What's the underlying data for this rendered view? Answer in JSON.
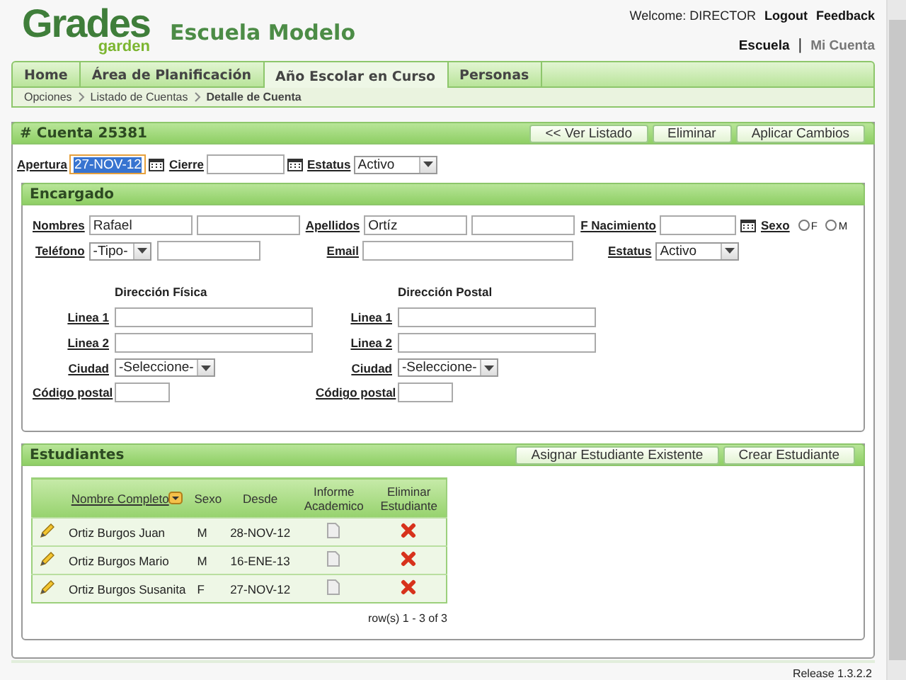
{
  "header": {
    "logo": {
      "title": "Grades",
      "subtitle": "garden"
    },
    "school": "Escuela Modelo",
    "welcome": "Welcome: DIRECTOR",
    "links": [
      "Logout",
      "Feedback"
    ],
    "context": [
      {
        "label": "Escuela",
        "selected": true
      },
      {
        "label": "Mi Cuenta",
        "selected": false
      }
    ],
    "separator": "|"
  },
  "tabs": [
    {
      "label": "Home",
      "selected": false
    },
    {
      "label": "Área de Planificación",
      "selected": false
    },
    {
      "label": "Año Escolar en Curso",
      "selected": true
    },
    {
      "label": "Personas",
      "selected": false
    }
  ],
  "breadcrumb": [
    {
      "label": "Opciones",
      "current": false
    },
    {
      "label": "Listado de Cuentas",
      "current": false
    },
    {
      "label": "Detalle de Cuenta",
      "current": true
    }
  ],
  "account": {
    "title": "# Cuenta 25381",
    "buttons": [
      "<< Ver Listado",
      "Eliminar",
      "Aplicar Cambios"
    ],
    "fields": [
      {
        "kind": "date",
        "label": "Apertura",
        "value": "27-NOV-12",
        "focused": true
      },
      {
        "kind": "date",
        "label": "Cierre"
      },
      {
        "kind": "select",
        "label": "Estatus",
        "value": "Activo"
      }
    ]
  },
  "guardian": {
    "title": "Encargado",
    "row1": {
      "nombres_label": "Nombres",
      "nombres": "Rafael",
      "apellidos_label": "Apellidos",
      "apellidos": "Ortíz",
      "birth_label": "F Nacimiento",
      "sexo_label": "Sexo",
      "sexo_options": [
        {
          "label": "F",
          "selected": false
        },
        {
          "label": "M",
          "selected": false
        }
      ]
    },
    "row2": {
      "phone_label": "Teléfono",
      "phone_type": "-Tipo-",
      "email_label": "Email",
      "status_label": "Estatus",
      "status": "Activo"
    },
    "addresses": [
      {
        "title": "Dirección Física",
        "line1_label": "Linea 1",
        "line2_label": "Linea 2",
        "city_label": "Ciudad",
        "city": "-Seleccione-",
        "zip_label": "Código postal"
      },
      {
        "title": "Dirección Postal",
        "line1_label": "Linea 1",
        "line2_label": "Linea 2",
        "city_label": "Ciudad",
        "city": "-Seleccione-",
        "zip_label": "Código postal"
      }
    ]
  },
  "students": {
    "title": "Estudiantes",
    "buttons": [
      "Asignar Estudiante Existente",
      "Crear Estudiante"
    ],
    "columns": [
      "Nombre Completo",
      "Sexo",
      "Desde",
      "Informe Academico",
      "Eliminar Estudiante"
    ],
    "rows": [
      {
        "name": "Ortiz Burgos Juan",
        "sex": "M",
        "since": "28-NOV-12"
      },
      {
        "name": "Ortiz Burgos Mario",
        "sex": "M",
        "since": "16-ENE-13"
      },
      {
        "name": "Ortiz Burgos Susanita",
        "sex": "F",
        "since": "27-NOV-12"
      }
    ],
    "pagination": "row(s) 1 - 3 of 3"
  },
  "footer": {
    "release": "Release 1.3.2.2"
  }
}
